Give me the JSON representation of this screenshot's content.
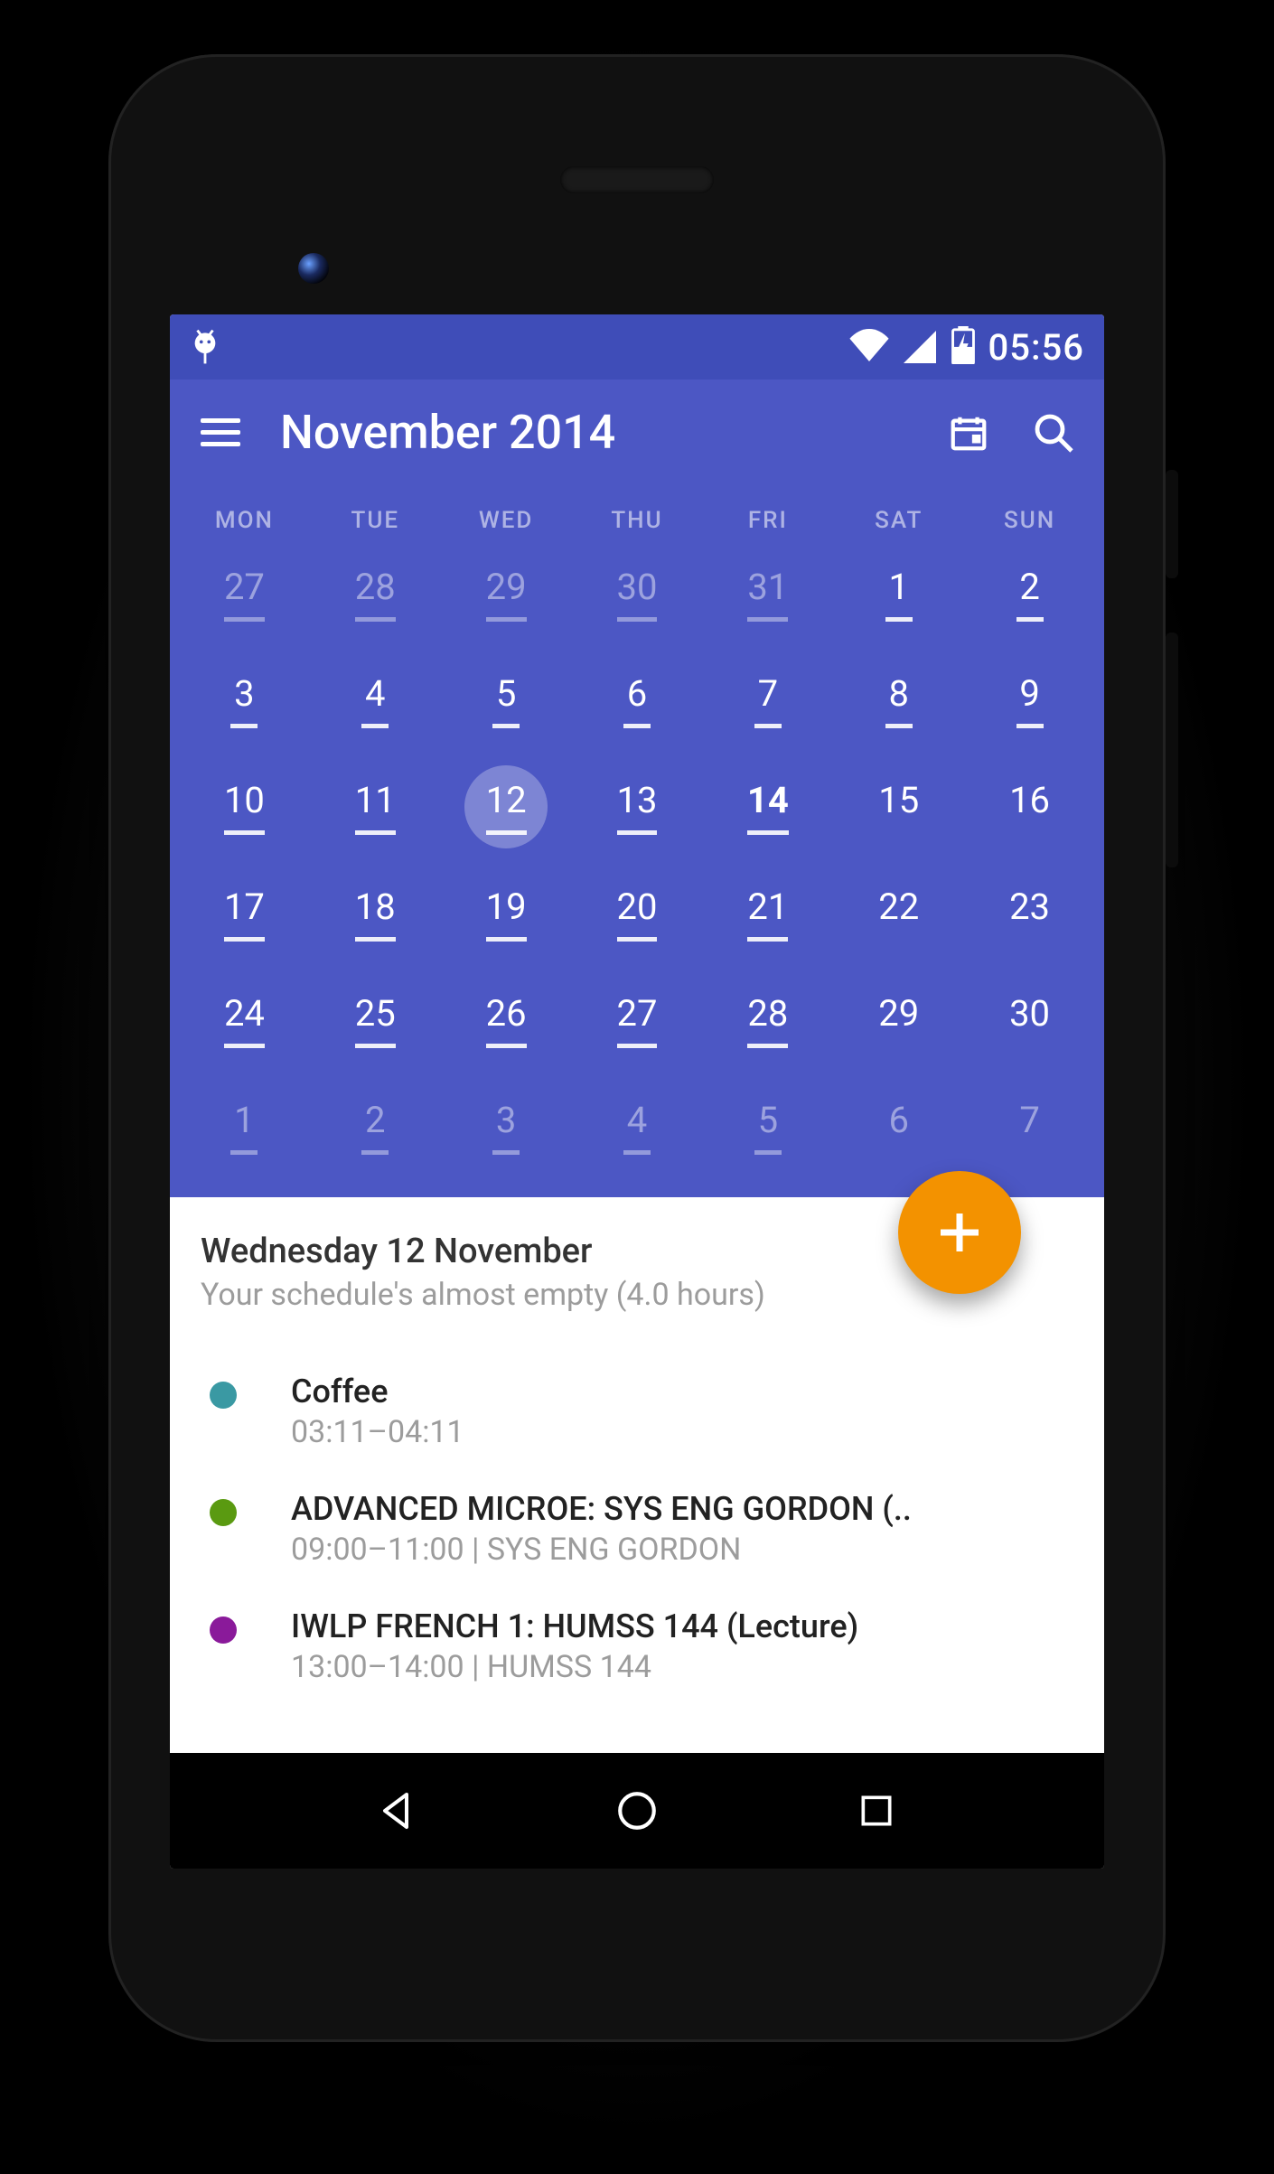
{
  "statusbar": {
    "time": "05:56"
  },
  "appbar": {
    "title": "November 2014"
  },
  "calendar": {
    "day_headers": [
      "MON",
      "TUE",
      "WED",
      "THU",
      "FRI",
      "SAT",
      "SUN"
    ],
    "weeks": [
      [
        {
          "n": "27",
          "dim": true,
          "mark": true
        },
        {
          "n": "28",
          "dim": true,
          "mark": true
        },
        {
          "n": "29",
          "dim": true,
          "mark": true
        },
        {
          "n": "30",
          "dim": true,
          "mark": true
        },
        {
          "n": "31",
          "dim": true,
          "mark": true
        },
        {
          "n": "1",
          "dim": false,
          "mark": true
        },
        {
          "n": "2",
          "dim": false,
          "mark": true
        }
      ],
      [
        {
          "n": "3",
          "dim": false,
          "mark": true
        },
        {
          "n": "4",
          "dim": false,
          "mark": true
        },
        {
          "n": "5",
          "dim": false,
          "mark": true
        },
        {
          "n": "6",
          "dim": false,
          "mark": true
        },
        {
          "n": "7",
          "dim": false,
          "mark": true
        },
        {
          "n": "8",
          "dim": false,
          "mark": true
        },
        {
          "n": "9",
          "dim": false,
          "mark": true
        }
      ],
      [
        {
          "n": "10",
          "dim": false,
          "mark": true
        },
        {
          "n": "11",
          "dim": false,
          "mark": true
        },
        {
          "n": "12",
          "dim": false,
          "mark": true,
          "selected": true
        },
        {
          "n": "13",
          "dim": false,
          "mark": true
        },
        {
          "n": "14",
          "dim": false,
          "mark": true,
          "today": true
        },
        {
          "n": "15",
          "dim": false,
          "mark": false
        },
        {
          "n": "16",
          "dim": false,
          "mark": false
        }
      ],
      [
        {
          "n": "17",
          "dim": false,
          "mark": true
        },
        {
          "n": "18",
          "dim": false,
          "mark": true
        },
        {
          "n": "19",
          "dim": false,
          "mark": true
        },
        {
          "n": "20",
          "dim": false,
          "mark": true
        },
        {
          "n": "21",
          "dim": false,
          "mark": true
        },
        {
          "n": "22",
          "dim": false,
          "mark": false
        },
        {
          "n": "23",
          "dim": false,
          "mark": false
        }
      ],
      [
        {
          "n": "24",
          "dim": false,
          "mark": true
        },
        {
          "n": "25",
          "dim": false,
          "mark": true
        },
        {
          "n": "26",
          "dim": false,
          "mark": true
        },
        {
          "n": "27",
          "dim": false,
          "mark": true
        },
        {
          "n": "28",
          "dim": false,
          "mark": true
        },
        {
          "n": "29",
          "dim": false,
          "mark": false
        },
        {
          "n": "30",
          "dim": false,
          "mark": false
        }
      ],
      [
        {
          "n": "1",
          "dim": true,
          "mark": true
        },
        {
          "n": "2",
          "dim": true,
          "mark": true
        },
        {
          "n": "3",
          "dim": true,
          "mark": true
        },
        {
          "n": "4",
          "dim": true,
          "mark": true
        },
        {
          "n": "5",
          "dim": true,
          "mark": true
        },
        {
          "n": "6",
          "dim": true,
          "mark": false
        },
        {
          "n": "7",
          "dim": true,
          "mark": false
        }
      ]
    ]
  },
  "agenda": {
    "heading": "Wednesday 12 November",
    "subheading": "Your schedule's almost empty (4.0 hours)",
    "events": [
      {
        "color": "#3a99a3",
        "title": "Coffee",
        "sub": "03:11–04:11"
      },
      {
        "color": "#5a9a11",
        "title": "ADVANCED MICROE: SYS ENG GORDON (..",
        "sub": "09:00–11:00 | SYS ENG GORDON"
      },
      {
        "color": "#8a1a9a",
        "title": "IWLP FRENCH 1: HUMSS 144 (Lecture)",
        "sub": "13:00–14:00 | HUMSS 144"
      }
    ]
  },
  "colors": {
    "primary": "#4c57c4",
    "primaryDark": "#3f4db8",
    "fab": "#f39200"
  }
}
